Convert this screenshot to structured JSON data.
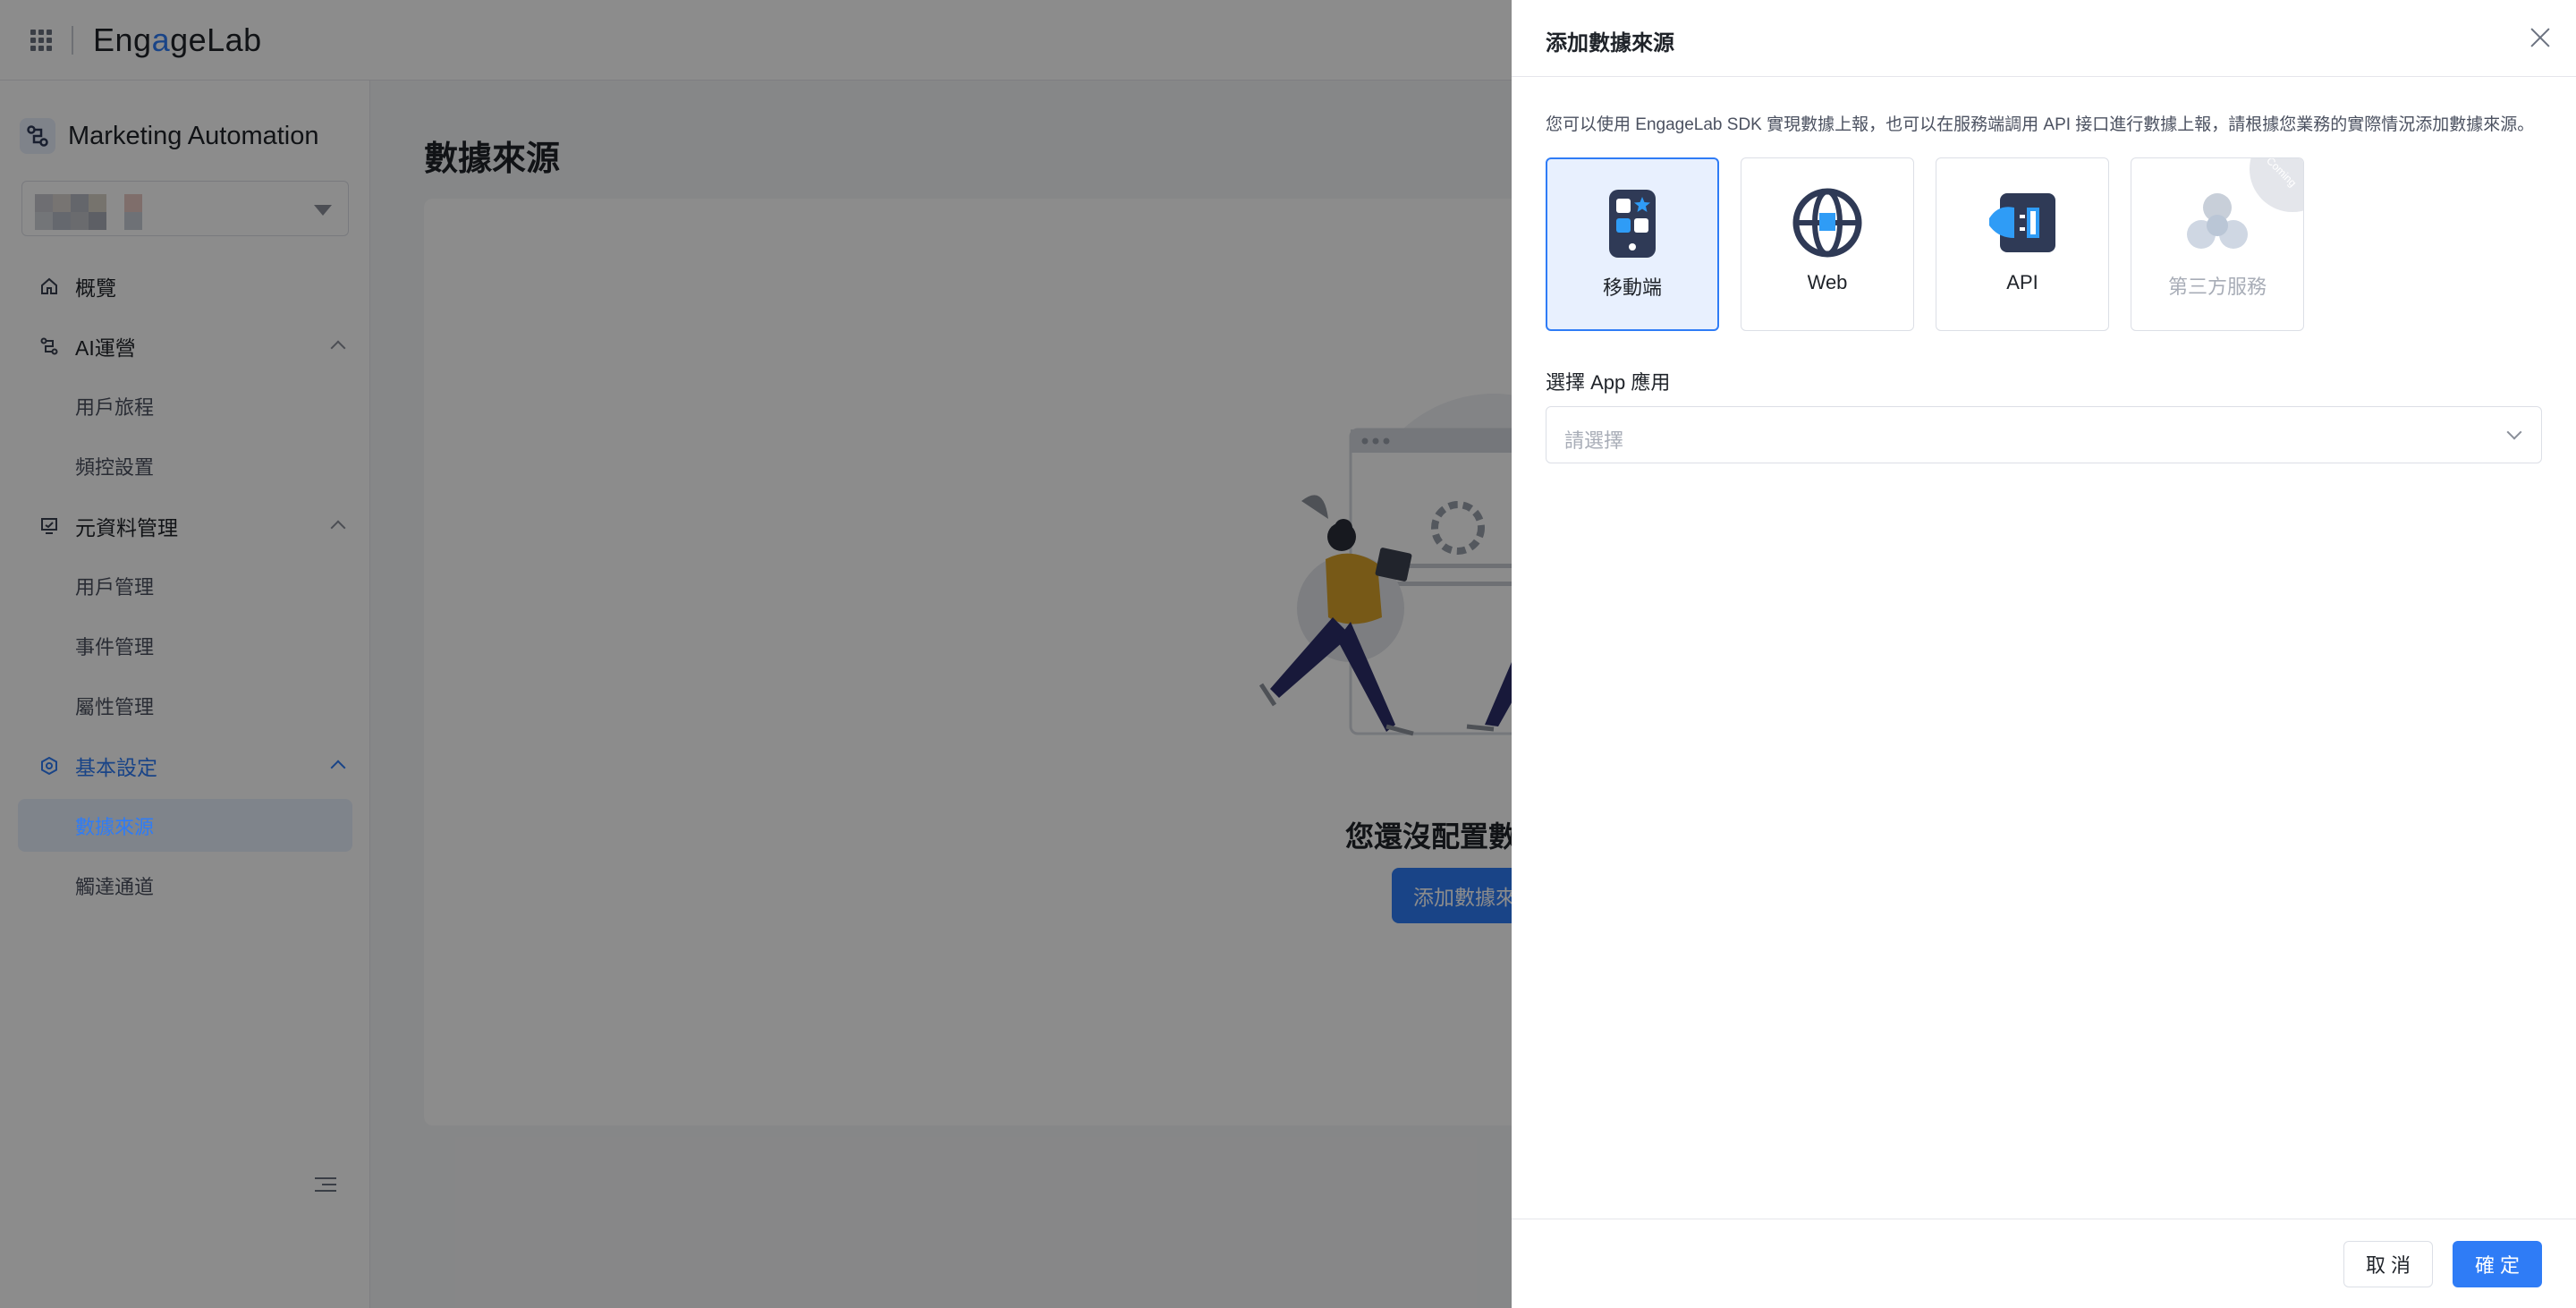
{
  "header": {
    "logo_text_a": "Eng",
    "logo_text_dot": "a",
    "logo_text_b": "geLab"
  },
  "sidebar": {
    "product_name": "Marketing Automation",
    "items": [
      {
        "label": "概覽",
        "icon": "home-icon"
      },
      {
        "label": "AI運營",
        "icon": "flow-icon"
      },
      {
        "label": "用戶旅程"
      },
      {
        "label": "頻控設置"
      },
      {
        "label": "元資料管理",
        "icon": "monitor-icon"
      },
      {
        "label": "用戶管理"
      },
      {
        "label": "事件管理"
      },
      {
        "label": "屬性管理"
      },
      {
        "label": "基本設定",
        "icon": "settings-icon"
      },
      {
        "label": "數據來源"
      },
      {
        "label": "觸達通道"
      }
    ]
  },
  "main": {
    "title": "數據來源",
    "empty_text": "您還沒配置數",
    "empty_button": "添加數據來"
  },
  "drawer": {
    "title": "添加數據來源",
    "description": "您可以使用 EngageLab SDK 實現數據上報，也可以在服務端調用 API 接口進行數據上報，請根據您業務的實際情況添加數據來源。",
    "cards": [
      {
        "label": "移動端",
        "icon": "mobile-icon",
        "state": "selected"
      },
      {
        "label": "Web",
        "icon": "globe-icon",
        "state": "default"
      },
      {
        "label": "API",
        "icon": "api-plug-icon",
        "state": "default"
      },
      {
        "label": "第三方服務",
        "icon": "third-party-icon",
        "state": "disabled",
        "ribbon": "Coming"
      }
    ],
    "app_label": "選擇 App 應用",
    "app_placeholder": "請選擇",
    "cancel": "取 消",
    "confirm": "確 定"
  },
  "colors": {
    "accent": "#2f7cf6",
    "overlay": "rgba(0,0,0,0.45)"
  }
}
